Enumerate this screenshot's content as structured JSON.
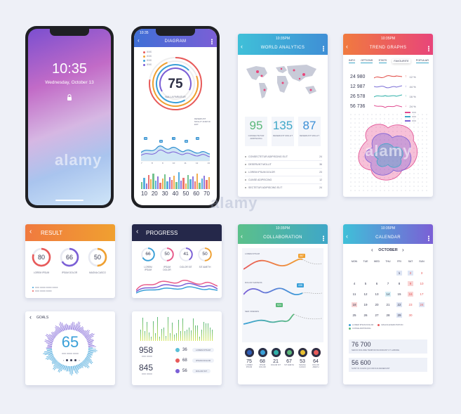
{
  "watermark": "alamy",
  "phone1": {
    "time": "10:35",
    "date": "Wednesday, October 13"
  },
  "phone2": {
    "status_time": "10:35",
    "title": "DIAGRAM",
    "legend": [
      "XXX",
      "XXX",
      "XXX",
      "XXX"
    ],
    "ring_value": "75",
    "ring_label": "NULLA PARIATUR",
    "note": "DESERUNT MOLLIT ANIM ID EST",
    "peaks": [
      "84",
      "83",
      "72",
      "80",
      "69"
    ],
    "x_labels": [
      "7",
      "8",
      "9",
      "10",
      "11",
      "12",
      "13"
    ],
    "bar_axis": [
      "10",
      "20",
      "30",
      "40",
      "50",
      "60",
      "70"
    ]
  },
  "world": {
    "status_time": "10:35PM",
    "title": "WORLD ANALYTICS",
    "stats": [
      {
        "value": "95",
        "label": "CONSECTETUR ADIPISCING",
        "color": "#5bb87a"
      },
      {
        "value": "135",
        "label": "DESERUNT MOLLIT",
        "color": "#3fa7c8"
      },
      {
        "value": "87",
        "label": "DESERUNT MOLLIT",
        "color": "#3b8fd6"
      }
    ],
    "list": [
      {
        "text": "CONSECTETUR ADIPISCING ELIT",
        "num": "24"
      },
      {
        "text": "DESERUNT MOLLIT",
        "num": "36"
      },
      {
        "text": "LOREM IPSUM DOLOR",
        "num": "23"
      },
      {
        "text": "CUNSE ADIPISCING",
        "num": "12"
      },
      {
        "text": "SECTETUR ADIPISCING ELIT",
        "num": "24"
      }
    ]
  },
  "trend": {
    "status_time": "10:35PM",
    "title": "TREND GRAPHS",
    "tabs": [
      "INFO",
      "OPTIONS",
      "STATS",
      "FAVOURITE",
      "POPULAR"
    ],
    "active_tab": 3,
    "rows": [
      {
        "value": "24 980",
        "pct": "12 %",
        "color": "#e0453f"
      },
      {
        "value": "12 987",
        "pct": "44 %",
        "color": "#7b6fd6"
      },
      {
        "value": "26 578",
        "pct": "16 %",
        "color": "#2fb0a8"
      },
      {
        "value": "56 736",
        "pct": "24 %",
        "color": "#e04a8f"
      }
    ],
    "legend": [
      "XXX",
      "XXX",
      "XXX"
    ]
  },
  "result": {
    "title": "RESULT",
    "rings": [
      {
        "value": "80",
        "label": "LOREM IPSUM",
        "pct": 0.8,
        "color": "#e85a5a"
      },
      {
        "value": "66",
        "label": "IPSUM DOLOR",
        "pct": 0.66,
        "color": "#7b5fd6"
      },
      {
        "value": "50",
        "label": "MAGNA CASCO",
        "pct": 0.5,
        "color": "#f0a030"
      }
    ],
    "notes": [
      "XXX XXXX XXXX XXXX",
      "XXX XXXX XXXX"
    ]
  },
  "progress": {
    "title": "PROGRESS",
    "rings": [
      {
        "value": "66",
        "label": "LOREM IPSUM",
        "pct": 0.66,
        "color": "#3aa0d8"
      },
      {
        "value": "50",
        "label": "IPSUM DOLOR",
        "pct": 0.5,
        "color": "#e85a8a"
      },
      {
        "value": "41",
        "label": "DOLOR SIT",
        "pct": 0.41,
        "color": "#7b5fd6"
      },
      {
        "value": "50",
        "label": "SIT AMETH",
        "pct": 0.5,
        "color": "#f0a030"
      }
    ]
  },
  "collab": {
    "status_time": "10:35PM",
    "title": "COLLABORATION",
    "series_labels": [
      "LOREM IPSUM",
      "DOLOR SAPIENS",
      "SED FRIENDS"
    ],
    "badges": [
      "567",
      "435",
      "524"
    ],
    "stats": [
      {
        "value": "75",
        "label": "LOREM IPSUM",
        "color": "#2f5fb8"
      },
      {
        "value": "68",
        "label": "IPSUM DOLOR",
        "color": "#3aa0d8"
      },
      {
        "value": "21",
        "label": "DOLOR SIT",
        "color": "#2fb0a8"
      },
      {
        "value": "67",
        "label": "SIT AMETH",
        "color": "#5bb87a"
      },
      {
        "value": "53",
        "label": "MAGNA CASCO",
        "color": "#e8c030"
      },
      {
        "value": "64",
        "label": "DOLOR AMETH",
        "color": "#e85a5a"
      }
    ]
  },
  "calendar": {
    "status_time": "10:35PM",
    "title": "CALENDAR",
    "month": "OCTOBER",
    "days": [
      "MON",
      "TUE",
      "WED",
      "THU",
      "FRI",
      "SAT",
      "SUN"
    ],
    "weeks": [
      [
        "",
        "",
        "",
        "",
        "1",
        "2",
        "3"
      ],
      [
        "4",
        "5",
        "6",
        "7",
        "8",
        "9",
        "10"
      ],
      [
        "11",
        "12",
        "13",
        "14",
        "15",
        "16",
        "17"
      ],
      [
        "18",
        "19",
        "20",
        "21",
        "22",
        "23",
        "24"
      ],
      [
        "25",
        "26",
        "27",
        "28",
        "29",
        "30",
        ""
      ]
    ],
    "legend": [
      "LOREM IPSUM DOLOR",
      "MAGNA EXERCITATION",
      "CUNSE ADIPISCING"
    ],
    "totals": [
      {
        "value": "76 700",
        "text": "SED ID DOLORE TEMPOR INCIDIDUNT UT LABORE"
      },
      {
        "value": "56 600",
        "text": "SUNT IN CULPA QUI OFFICIA DESERUNT"
      }
    ]
  },
  "goals": {
    "title": "GOALS",
    "value": "65",
    "note": "XXX XXXX XXXX"
  },
  "equalizer": {
    "values": [
      {
        "value": "958",
        "note": "XXX XXXX"
      },
      {
        "value": "845",
        "note": "XXX XXXX"
      }
    ],
    "chips": [
      {
        "value": "36",
        "label": "LOREM IPSUM",
        "color": "#5bc0d8"
      },
      {
        "value": "68",
        "label": "IPSUM DOLOR",
        "color": "#e85a5a"
      },
      {
        "value": "56",
        "label": "DOLOR SIT",
        "color": "#7b5fd6"
      }
    ]
  }
}
